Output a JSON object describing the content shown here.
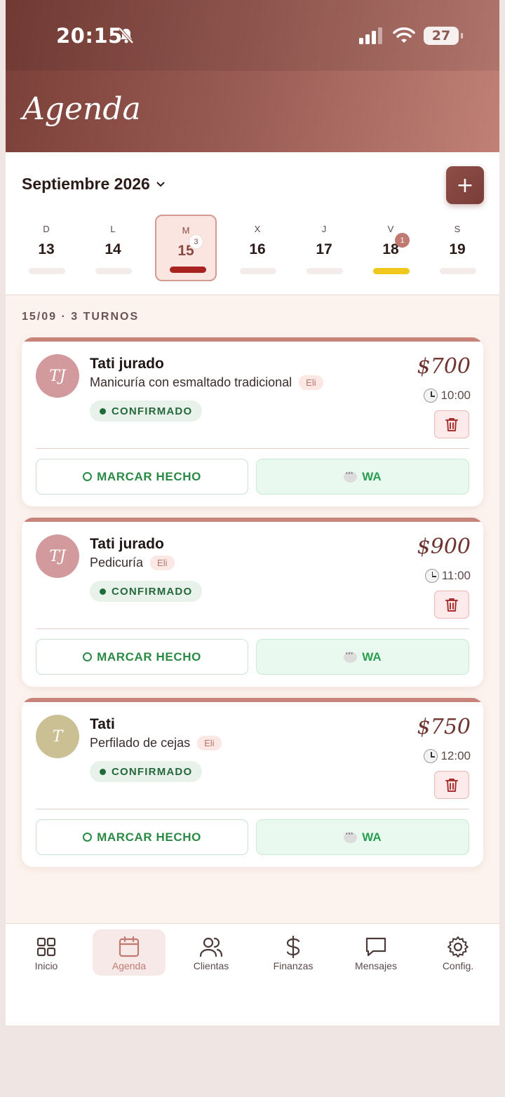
{
  "status_bar": {
    "time": "20:15",
    "battery": "27"
  },
  "header": {
    "title": "Agenda"
  },
  "calendar": {
    "month_label": "Septiembre 2026",
    "add_label": "+",
    "days": [
      {
        "dow": "D",
        "num": "13",
        "badge": "",
        "selected": false
      },
      {
        "dow": "L",
        "num": "14",
        "badge": "",
        "selected": false
      },
      {
        "dow": "M",
        "num": "15",
        "badge": "3",
        "selected": true
      },
      {
        "dow": "X",
        "num": "16",
        "badge": "",
        "selected": false
      },
      {
        "dow": "J",
        "num": "17",
        "badge": "",
        "selected": false
      },
      {
        "dow": "V",
        "num": "18",
        "badge": "1",
        "selected": false
      },
      {
        "dow": "S",
        "num": "19",
        "badge": "",
        "selected": false
      }
    ]
  },
  "list": {
    "heading": "15/09 · 3 TURNOS",
    "appointments": [
      {
        "initials": "TJ",
        "avatar_color": "#d29a9c",
        "name": "Tati jurado",
        "service": "Manicuría con esmaltado tradicional",
        "staff": "Eli",
        "status": "CONFIRMADO",
        "price": "$700",
        "time": "10:00",
        "done_label": "MARCAR HECHO",
        "wa_label": "WA"
      },
      {
        "initials": "TJ",
        "avatar_color": "#d29a9c",
        "name": "Tati jurado",
        "service": "Pedicuría",
        "staff": "Eli",
        "status": "CONFIRMADO",
        "price": "$900",
        "time": "11:00",
        "done_label": "MARCAR HECHO",
        "wa_label": "WA"
      },
      {
        "initials": "T",
        "avatar_color": "#cbbf94",
        "name": "Tati",
        "service": "Perfilado de cejas",
        "staff": "Eli",
        "status": "CONFIRMADO",
        "price": "$750",
        "time": "12:00",
        "done_label": "MARCAR HECHO",
        "wa_label": "WA"
      }
    ]
  },
  "nav": {
    "items": [
      {
        "label": "Inicio",
        "icon": "grid-icon"
      },
      {
        "label": "Agenda",
        "icon": "calendar-icon"
      },
      {
        "label": "Clientas",
        "icon": "users-icon"
      },
      {
        "label": "Finanzas",
        "icon": "dollar-icon"
      },
      {
        "label": "Mensajes",
        "icon": "message-icon"
      },
      {
        "label": "Config.",
        "icon": "gear-icon"
      }
    ]
  },
  "colors": {
    "accent": "#7a3d38",
    "confirmed": "#24683c",
    "bar_selected": "#a82222",
    "bar_yellow": "#f0c81d"
  }
}
